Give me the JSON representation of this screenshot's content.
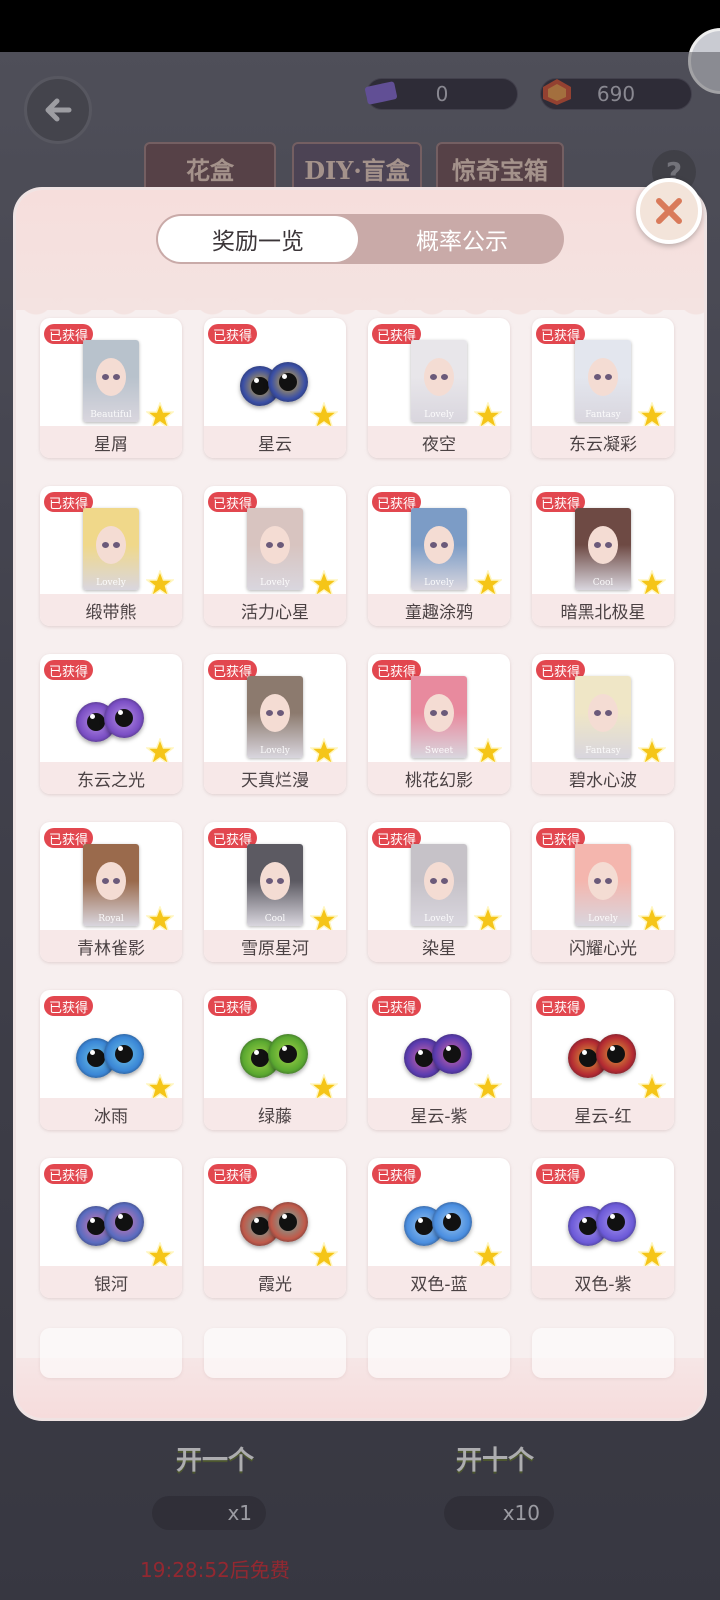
{
  "header": {
    "ticket_count": "0",
    "gem_count": "690",
    "bg_tabs": [
      "花盒",
      "DIY·盲盒",
      "惊奇宝箱"
    ],
    "help": "?"
  },
  "modal": {
    "tabs": [
      {
        "label": "奖励一览",
        "active": true
      },
      {
        "label": "概率公示",
        "active": false
      }
    ],
    "obtained_label": "已获得",
    "items": [
      {
        "name": "星屑",
        "kind": "portrait",
        "tag": "Beautiful",
        "hair": "#b8c2cc"
      },
      {
        "name": "星云",
        "kind": "lens",
        "color": "#3a4fa6",
        "color2": "#d8b23a"
      },
      {
        "name": "夜空",
        "kind": "portrait",
        "tag": "Lovely",
        "hair": "#e8e6ea"
      },
      {
        "name": "东云凝彩",
        "kind": "portrait",
        "tag": "Fantasy",
        "hair": "#e3e6ee"
      },
      {
        "name": "缎带熊",
        "kind": "portrait",
        "tag": "Lovely",
        "hair": "#f0d88a"
      },
      {
        "name": "活力心星",
        "kind": "portrait",
        "tag": "Lovely",
        "hair": "#d8c4c0"
      },
      {
        "name": "童趣涂鸦",
        "kind": "portrait",
        "tag": "Lovely",
        "hair": "#7c9cc6"
      },
      {
        "name": "暗黑北极星",
        "kind": "portrait",
        "tag": "Cool",
        "hair": "#6e4a44"
      },
      {
        "name": "东云之光",
        "kind": "lens",
        "color": "#7a4ec4",
        "color2": "#b890e6"
      },
      {
        "name": "天真烂漫",
        "kind": "portrait",
        "tag": "Lovely",
        "hair": "#8c7a6e"
      },
      {
        "name": "桃花幻影",
        "kind": "portrait",
        "tag": "Sweet",
        "hair": "#e88a9e"
      },
      {
        "name": "碧水心波",
        "kind": "portrait",
        "tag": "Fantasy",
        "hair": "#efe6c6"
      },
      {
        "name": "青林雀影",
        "kind": "portrait",
        "tag": "Royal",
        "hair": "#9a6a4c"
      },
      {
        "name": "雪原星河",
        "kind": "portrait",
        "tag": "Cool",
        "hair": "#5c5a62"
      },
      {
        "name": "染星",
        "kind": "portrait",
        "tag": "Lovely",
        "hair": "#c6c2c8"
      },
      {
        "name": "闪耀心光",
        "kind": "portrait",
        "tag": "Lovely",
        "hair": "#f4b6ae"
      },
      {
        "name": "冰雨",
        "kind": "lens",
        "color": "#3a86d6",
        "color2": "#6fc4e8"
      },
      {
        "name": "绿藤",
        "kind": "lens",
        "color": "#5aa830",
        "color2": "#a6d64a"
      },
      {
        "name": "星云-紫",
        "kind": "lens",
        "color": "#5b3cb0",
        "color2": "#d86aa6"
      },
      {
        "name": "星云-红",
        "kind": "lens",
        "color": "#b42a32",
        "color2": "#e0a43a"
      },
      {
        "name": "银河",
        "kind": "lens",
        "color": "#5a6cc0",
        "color2": "#d67ab2"
      },
      {
        "name": "霞光",
        "kind": "lens",
        "color": "#c05a4a",
        "color2": "#6ab0a8"
      },
      {
        "name": "双色-蓝",
        "kind": "lens",
        "color": "#4a8ee0",
        "color2": "#9cc6ee"
      },
      {
        "name": "双色-紫",
        "kind": "lens",
        "color": "#6c5ad8",
        "color2": "#a896ee"
      }
    ]
  },
  "bottom": {
    "open_one": "开一个",
    "open_ten": "开十个",
    "cost_one": "x1",
    "cost_ten": "x10",
    "free_timer": "19:28:52后免费"
  },
  "colors": {
    "badge": "#e2474f",
    "accent": "#c9aaa8",
    "star": "#f5c518"
  }
}
